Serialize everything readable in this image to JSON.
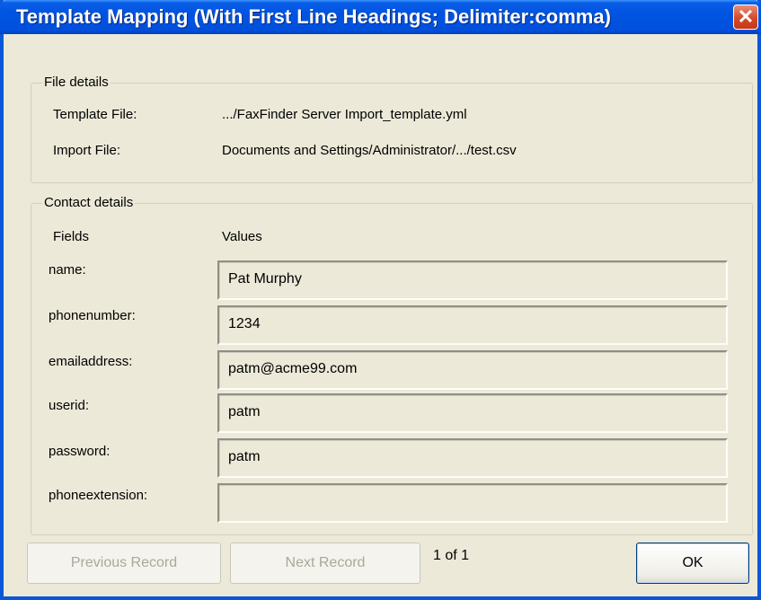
{
  "window": {
    "title": "Template Mapping (With First Line Headings; Delimiter:comma)",
    "close_label": "✕"
  },
  "file_details": {
    "legend": "File details",
    "template_label": "Template File:",
    "template_value": ".../FaxFinder Server Import_template.yml",
    "import_label": "Import File:",
    "import_value": "Documents and Settings/Administrator/.../test.csv"
  },
  "contact_details": {
    "legend": "Contact details",
    "fields_header": "Fields",
    "values_header": "Values",
    "rows": [
      {
        "label": "name:",
        "value": "Pat Murphy"
      },
      {
        "label": "phonenumber:",
        "value": "1234"
      },
      {
        "label": "emailaddress:",
        "value": "patm@acme99.com"
      },
      {
        "label": "userid:",
        "value": "patm"
      },
      {
        "label": "password:",
        "value": "patm"
      },
      {
        "label": "phoneextension:",
        "value": ""
      }
    ]
  },
  "footer": {
    "previous_label": "Previous Record",
    "next_label": "Next Record",
    "record_counter": "1 of 1",
    "ok_label": "OK"
  },
  "colors": {
    "titlebar": "#0053e0",
    "close_button": "#d34a2a",
    "dialog_background": "#ece9d8",
    "disabled_text": "#aca899"
  }
}
